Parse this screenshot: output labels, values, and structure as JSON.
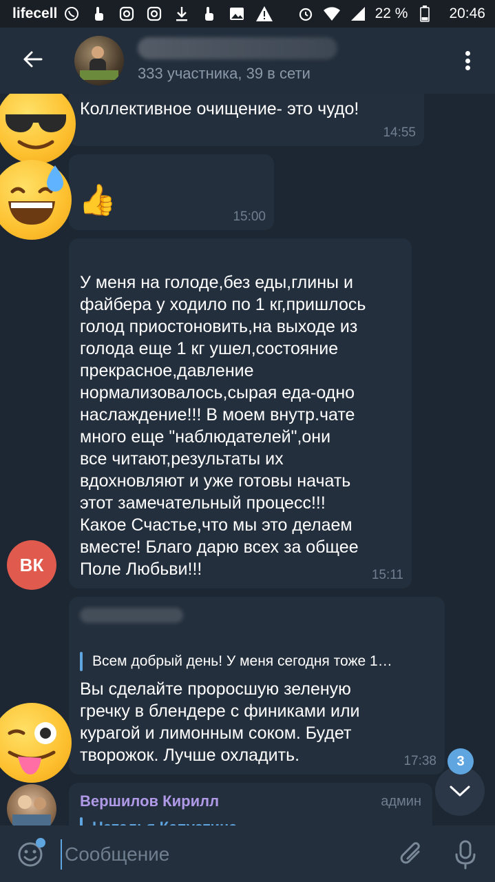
{
  "status_bar": {
    "carrier": "lifecell",
    "battery": "22 %",
    "time": "20:46",
    "icons": [
      "viber-icon",
      "touch-icon",
      "instagram-icon",
      "instagram-icon",
      "download-icon",
      "touch-icon",
      "image-icon",
      "warning-icon",
      "alarm-icon",
      "wifi-icon",
      "signal-icon",
      "battery-icon"
    ]
  },
  "header": {
    "subtitle": "333 участника, 39 в сети"
  },
  "messages": [
    {
      "text": "Коллективное очищение- это чудо!",
      "time": "14:55"
    },
    {
      "emoji": "👍",
      "time": "15:00"
    },
    {
      "avatar": "ВК",
      "text": "У меня на голоде,без еды,глины и\nфайбера у ходило по 1 кг,пришлось\nголод приостоновить,на выходе из\nголода еще 1 кг ушел,состояние\nпрекрасное,давление\nнормализовалось,сырая еда-одно\nнаслаждение!!! В моем внутр.чате\nмного еще \"наблюдателей\",они\nвсе читают,результаты их\nвдохновляют и уже готовы начать\nэтот замечательный процесс!!!\nКакое Счастье,что мы это делаем\nвместе! Благо дарю всех за общее\nПоле Любьви!!!",
      "time": "15:11"
    },
    {
      "reply_text": "Всем добрый день! У меня сегодня тоже 1…",
      "text": "Вы сделайте проросшую зеленую\nгречку в блендере с финиками или\nкурагой и лимонным соком. Будет\nтворожок. Лучше охладить.",
      "time": "17:38"
    },
    {
      "author": "Вершилов Кирилл",
      "role": "админ",
      "reply_author": "Наталья Капустина"
    }
  ],
  "unread_count": "3",
  "input": {
    "placeholder": "Сообщение"
  },
  "colors": {
    "background": "#1d2733",
    "bubble": "#242f3d",
    "accent": "#5fa6e0",
    "admin_name": "#b09ae8",
    "vk_avatar": "#e05a4d"
  }
}
